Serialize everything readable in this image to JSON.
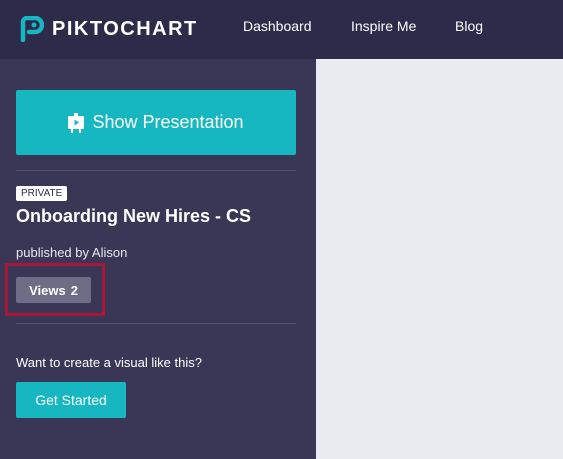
{
  "brand": {
    "name": "PIKTOCHART",
    "logo_icon": "piktochart-logo-icon",
    "accent": "#16b7c0"
  },
  "nav": [
    {
      "label": "Dashboard"
    },
    {
      "label": "Inspire Me"
    },
    {
      "label": "Blog"
    }
  ],
  "sidebar": {
    "show_presentation": {
      "label": "Show Presentation",
      "icon": "presentation-icon"
    },
    "visibility_badge": "PRIVATE",
    "title": "Onboarding New Hires - CS",
    "published_prefix": "published by",
    "author": "Alison",
    "views": {
      "label": "Views",
      "count": "2"
    },
    "cta": {
      "text": "Want to create a visual like this?",
      "button": "Get Started"
    }
  },
  "colors": {
    "topbar": "#2e2a4a",
    "sidebar": "#3a3656",
    "canvas": "#e9ebf0",
    "highlight": "#a8173a"
  }
}
